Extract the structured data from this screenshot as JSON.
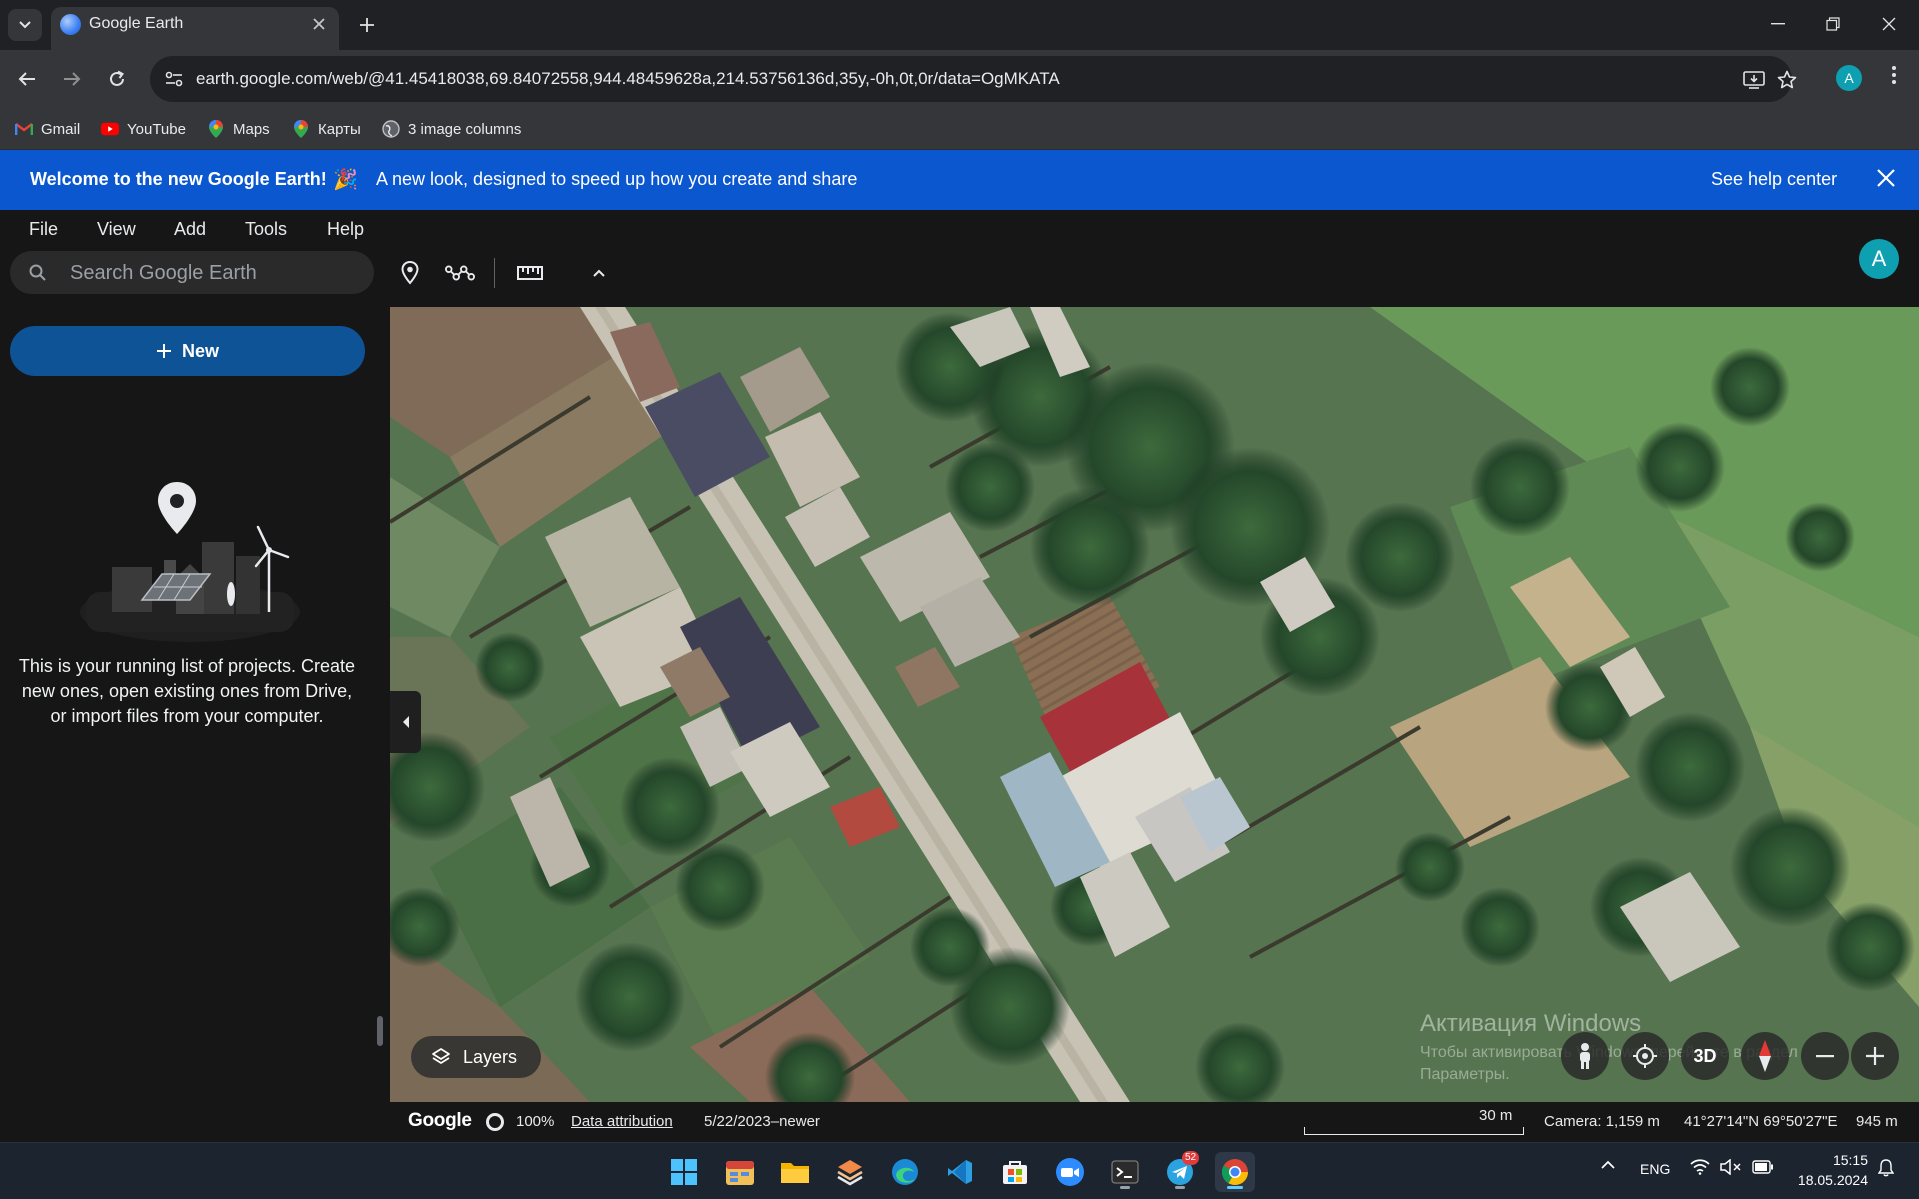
{
  "browser": {
    "tab_title": "Google Earth",
    "url": "earth.google.com/web/@41.45418038,69.84072558,944.48459628a,214.53756136d,35y,-0h,0t,0r/data=OgMKATA"
  },
  "bookmarks": [
    {
      "label": "Gmail",
      "icon": "gmail-icon"
    },
    {
      "label": "YouTube",
      "icon": "youtube-icon"
    },
    {
      "label": "Maps",
      "icon": "maps-pin-icon"
    },
    {
      "label": "Карты",
      "icon": "maps-pin-icon"
    },
    {
      "label": "3 image columns",
      "icon": "globe-icon"
    }
  ],
  "banner": {
    "title": "Welcome to the new Google Earth!",
    "emoji": "🎉",
    "message": "A new look, designed to speed up how you create and share",
    "help_link": "See help center",
    "color": "#0b57d0"
  },
  "menu": [
    "File",
    "View",
    "Add",
    "Tools",
    "Help"
  ],
  "search": {
    "placeholder": "Search Google Earth"
  },
  "profile_initial": "A",
  "projects": {
    "new_label": "New",
    "empty_text": "This is your running list of projects. Create new ones, open existing ones from Drive, or import files from your computer."
  },
  "map": {
    "layers_label": "Layers",
    "controls": [
      "pegman-icon",
      "my-location-icon",
      "3D",
      "compass-icon",
      "zoom-out-icon",
      "zoom-in-icon"
    ],
    "three_d_label": "3D",
    "watermark_line1": "Активация Windows",
    "watermark_line2": "Чтобы активировать Windows, перейдите в раздел",
    "watermark_line3": "Параметры."
  },
  "status": {
    "google": "Google",
    "streaming_percent": "100%",
    "data_attribution": "Data attribution",
    "imagery_date": "5/22/2023–newer",
    "scale": "30 m",
    "camera": "Camera: 1,159 m",
    "coordinates": "41°27'14\"N 69°50'27\"E",
    "elevation": "945 m"
  },
  "taskbar": {
    "apps": [
      "windows-start-icon",
      "calendar-widget-icon",
      "file-explorer-icon",
      "stack-app-icon",
      "edge-icon",
      "vscode-icon",
      "store-icon",
      "zoom-icon",
      "terminal-icon",
      "telegram-icon",
      "chrome-icon"
    ],
    "telegram_badge": "52",
    "language": "ENG",
    "time": "15:15",
    "date": "18.05.2024"
  }
}
